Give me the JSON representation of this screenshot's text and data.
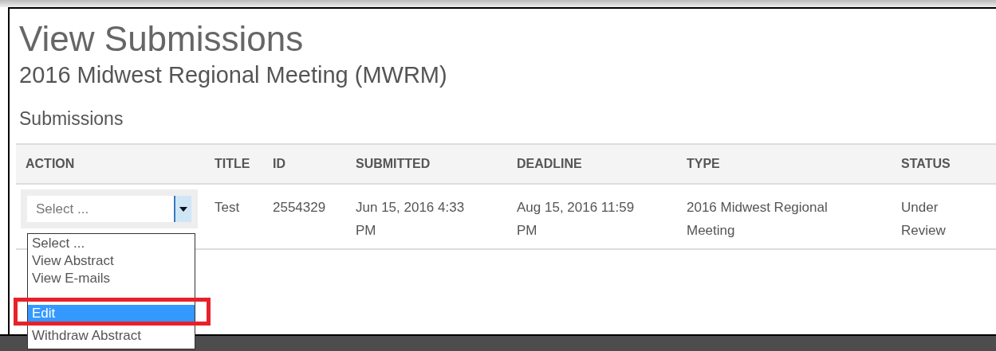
{
  "page": {
    "title": "View Submissions",
    "subtitle": "2016 Midwest Regional Meeting (MWRM)",
    "section": "Submissions"
  },
  "table": {
    "columns": [
      "ACTION",
      "TITLE",
      "ID",
      "SUBMITTED",
      "DEADLINE",
      "TYPE",
      "STATUS"
    ],
    "rows": [
      {
        "action": {
          "value": "Select ...",
          "expanded": true
        },
        "title": "Test",
        "id": "2554329",
        "submitted": "Jun 15, 2016 4:33 PM",
        "deadline": "Aug 15, 2016 11:59 PM",
        "type": "2016 Midwest Regional Meeting",
        "status": "Under Review"
      }
    ]
  },
  "dropdown": {
    "options": [
      {
        "kind": "option",
        "label": "Select ...",
        "selected": false
      },
      {
        "kind": "option",
        "label": "View Abstract",
        "selected": false
      },
      {
        "kind": "option",
        "label": "View E-mails",
        "selected": false
      },
      {
        "kind": "blank",
        "selected": false
      },
      {
        "kind": "option",
        "label": "Edit",
        "selected": true
      },
      {
        "kind": "option",
        "label": "Withdraw Abstract",
        "selected": false
      }
    ]
  }
}
